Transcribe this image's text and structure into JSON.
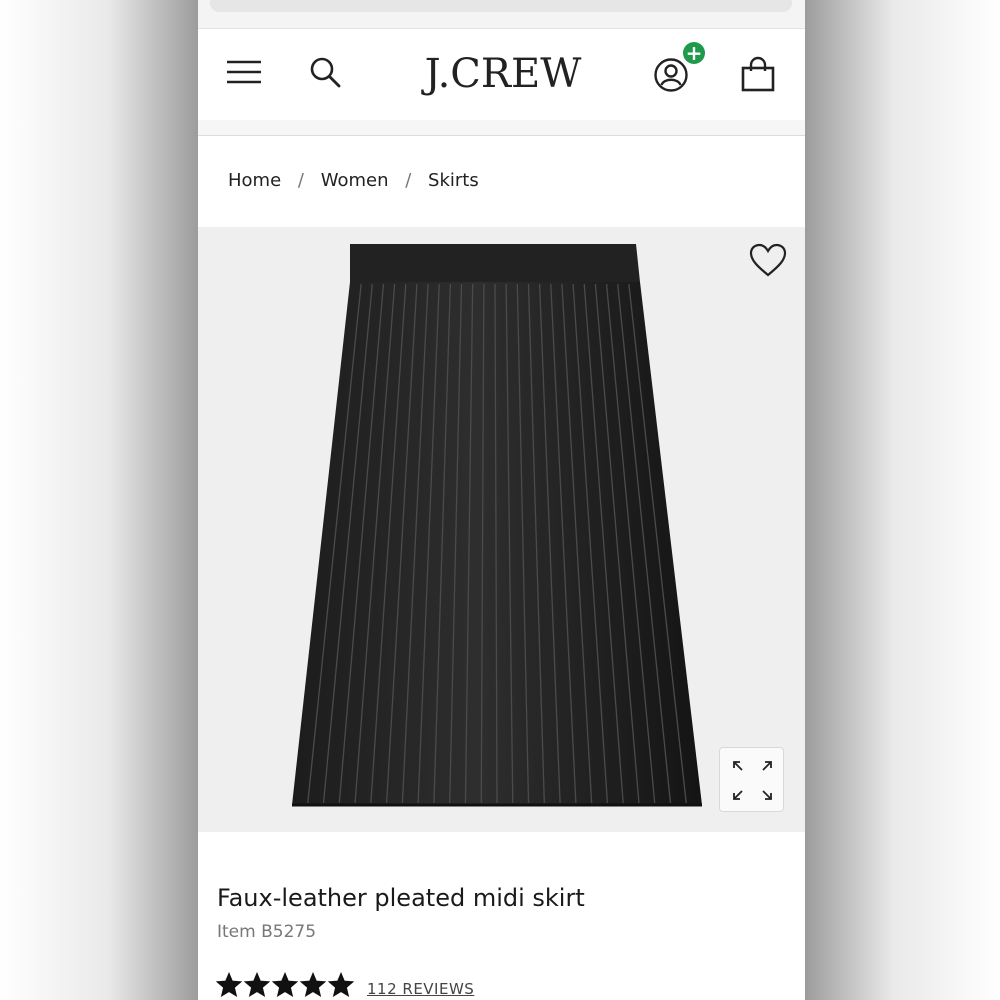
{
  "header": {
    "logo_text": "J.CREW",
    "icons": [
      "menu-icon",
      "search-icon",
      "account-icon",
      "plus-icon",
      "bag-icon"
    ],
    "badge_color": "#1f9a4c"
  },
  "breadcrumb": {
    "items": [
      "Home",
      "Women",
      "Skirts"
    ],
    "separator": "/"
  },
  "product": {
    "title": "Faux-leather pleated midi skirt",
    "item_number": "Item B5275",
    "rating": 5,
    "rating_max": 5,
    "reviews_label": "112 REVIEWS",
    "image_icons": [
      "heart-icon",
      "expand-icon"
    ]
  }
}
